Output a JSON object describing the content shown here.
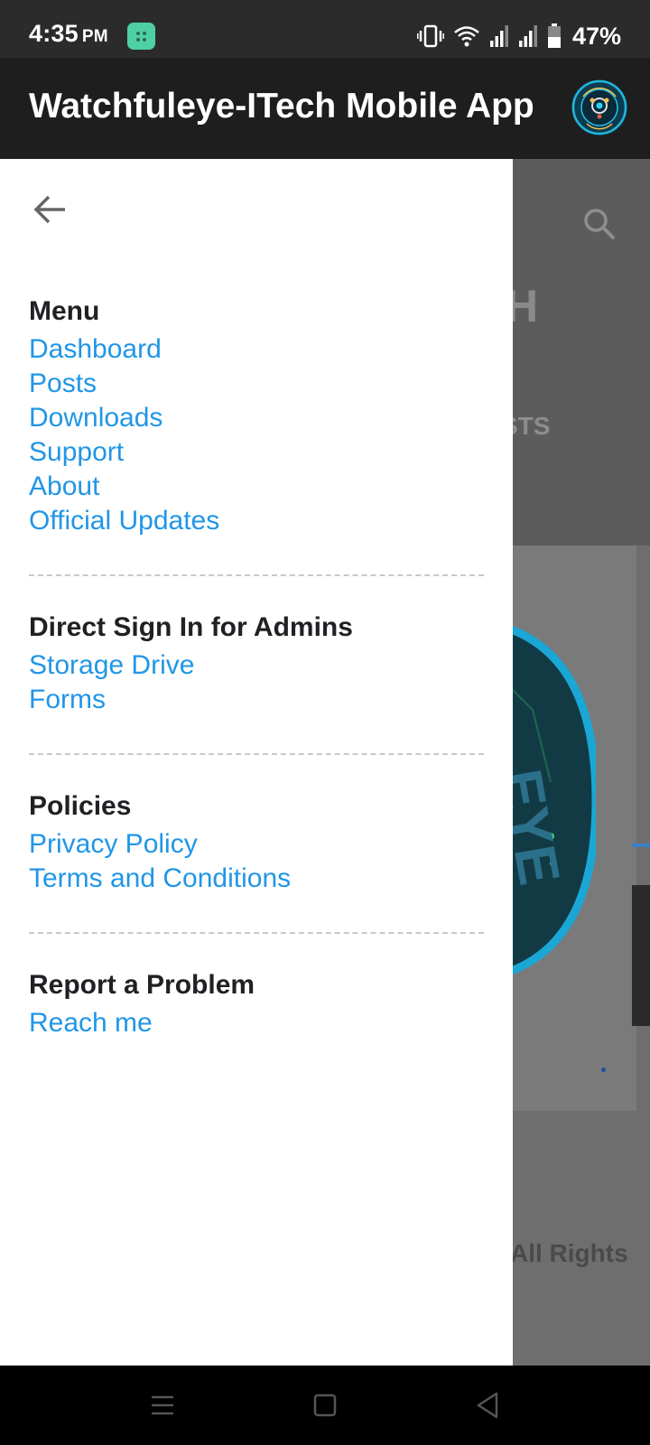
{
  "status_bar": {
    "time": "4:35",
    "ampm": "PM",
    "battery": "47%",
    "icons": [
      "app-notification-icon",
      "vibrate-icon",
      "wifi-icon",
      "signal-icon",
      "signal-icon",
      "battery-icon"
    ]
  },
  "app_bar": {
    "title": "Watchfuleye-ITech Mobile App",
    "logo_icon": "watchfuleye-logo"
  },
  "background": {
    "partial_heading": "H",
    "partial_tab": "STS",
    "partial_footer": "All Rights"
  },
  "drawer": {
    "back_icon": "arrow-back-icon",
    "sections": [
      {
        "title": "Menu",
        "links": [
          "Dashboard",
          "Posts",
          "Downloads",
          "Support",
          "About",
          "Official Updates"
        ]
      },
      {
        "title": "Direct Sign In for Admins",
        "links": [
          "Storage Drive",
          "Forms"
        ]
      },
      {
        "title": "Policies",
        "links": [
          "Privacy Policy",
          "Terms and Conditions"
        ]
      },
      {
        "title": "Report a Problem",
        "links": [
          "Reach me"
        ]
      }
    ]
  },
  "nav_bar": {
    "icons": [
      "recent-apps-icon",
      "home-icon",
      "back-icon"
    ]
  },
  "colors": {
    "link": "#2196e6",
    "app_bar": "#1e1e1e",
    "status_bar": "#2b2b2b",
    "scrim": "#6e6e6e"
  }
}
